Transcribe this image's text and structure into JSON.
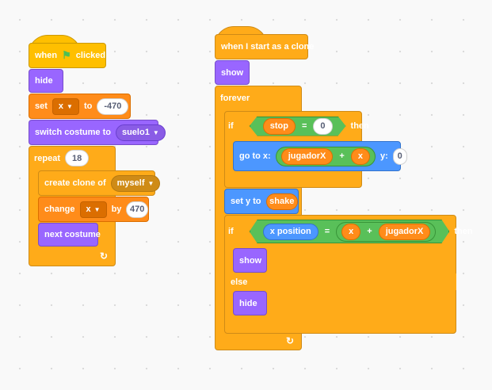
{
  "script1": {
    "hat": {
      "when": "when",
      "clicked": "clicked"
    },
    "hide": "hide",
    "set": {
      "label": "set",
      "var": "x",
      "to": "to",
      "value": "-470"
    },
    "switch_costume": {
      "label": "switch costume to",
      "costume": "suelo1"
    },
    "repeat": {
      "label": "repeat",
      "times": "18"
    },
    "create_clone": {
      "label": "create clone of",
      "target": "myself"
    },
    "change": {
      "label": "change",
      "var": "x",
      "by": "by",
      "value": "470"
    },
    "next_costume": "next costume"
  },
  "script2": {
    "hat": "when I start as a clone",
    "show": "show",
    "forever": "forever",
    "if1": {
      "if": "if",
      "var": "stop",
      "eq": "=",
      "value": "0",
      "then": "then"
    },
    "goto": {
      "label": "go to x:",
      "a": "jugadorX",
      "plus": "+",
      "b": "x",
      "y_label": "y:",
      "y_value": "0"
    },
    "set_y": {
      "label": "set y to",
      "var": "shake"
    },
    "if2": {
      "if": "if",
      "reporter": "x position",
      "eq": "=",
      "a": "x",
      "plus": "+",
      "b": "jugadorX",
      "then": "then"
    },
    "else": "else",
    "hide": "hide"
  },
  "icons": {
    "green_flag": "green-flag-icon",
    "loop_arrow": "loop-arrow-icon",
    "dropdown": "dropdown-caret-icon"
  },
  "colors": {
    "events": "#ffbf00",
    "looks": "#9966ff",
    "variables": "#ff8c1a",
    "control": "#ffab19",
    "motion": "#4c97ff",
    "operators": "#59c059"
  }
}
